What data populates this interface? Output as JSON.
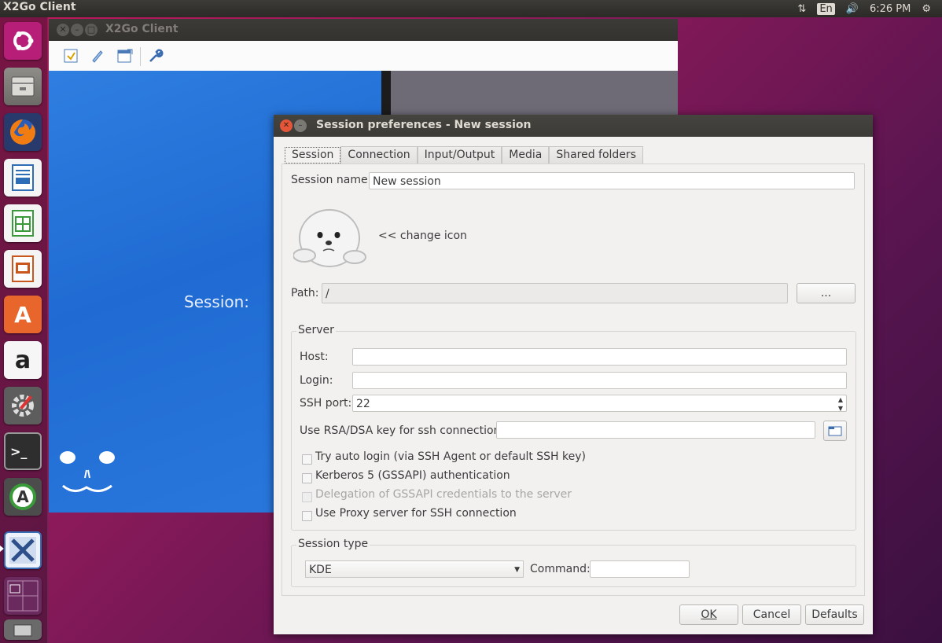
{
  "top_panel": {
    "app_title": "X2Go Client",
    "language": "En",
    "time": "6:26 PM"
  },
  "launcher": {
    "items": [
      {
        "name": "ubuntu-dash-icon",
        "color": "#c3217e"
      },
      {
        "name": "files-icon",
        "color": "#9a9994"
      },
      {
        "name": "firefox-icon",
        "color": "#e66000"
      },
      {
        "name": "writer-icon",
        "color": "#2d6db5"
      },
      {
        "name": "calc-icon",
        "color": "#3a9a3a"
      },
      {
        "name": "impress-icon",
        "color": "#c9561b"
      },
      {
        "name": "software-center-icon",
        "color": "#e8652c"
      },
      {
        "name": "amazon-icon",
        "color": "#f2f2f2"
      },
      {
        "name": "system-settings-icon",
        "color": "#5d5d5d"
      },
      {
        "name": "terminal-icon",
        "color": "#2e2e2e"
      },
      {
        "name": "software-updater-icon",
        "color": "#4c4c4c"
      },
      {
        "name": "x2go-icon",
        "color": "#3b6fb5"
      },
      {
        "name": "workspace-switcher-icon",
        "color": "#6a2a5e"
      },
      {
        "name": "trash-icon",
        "color": "#8a8a8a"
      }
    ]
  },
  "x2go_window": {
    "title": "X2Go Client",
    "session_label": "Session:"
  },
  "dialog": {
    "title": "Session preferences - New session",
    "tabs": [
      {
        "label": "Session",
        "active": true
      },
      {
        "label": "Connection",
        "active": false
      },
      {
        "label": "Input/Output",
        "active": false
      },
      {
        "label": "Media",
        "active": false
      },
      {
        "label": "Shared folders",
        "active": false
      }
    ],
    "session_name_label": "Session name:",
    "session_name_value": "New session",
    "change_icon_label": "<< change icon",
    "path_label": "Path:",
    "path_value": "/",
    "path_browse_label": "...",
    "server": {
      "title": "Server",
      "host_label": "Host:",
      "host_value": "",
      "login_label": "Login:",
      "login_value": "",
      "ssh_port_label": "SSH port:",
      "ssh_port_value": "22",
      "key_label": "Use RSA/DSA key for ssh connection:",
      "key_value": "",
      "options": [
        {
          "label": "Try auto login (via SSH Agent or default SSH key)",
          "checked": false,
          "enabled": true
        },
        {
          "label": "Kerberos 5 (GSSAPI) authentication",
          "checked": false,
          "enabled": true
        },
        {
          "label": "Delegation of GSSAPI credentials to the server",
          "checked": false,
          "enabled": false
        },
        {
          "label": "Use Proxy server for SSH connection",
          "checked": false,
          "enabled": true
        }
      ]
    },
    "session_type": {
      "title": "Session type",
      "selected": "KDE",
      "command_label": "Command:",
      "command_value": ""
    },
    "buttons": {
      "ok": "OK",
      "cancel": "Cancel",
      "defaults": "Defaults"
    }
  }
}
